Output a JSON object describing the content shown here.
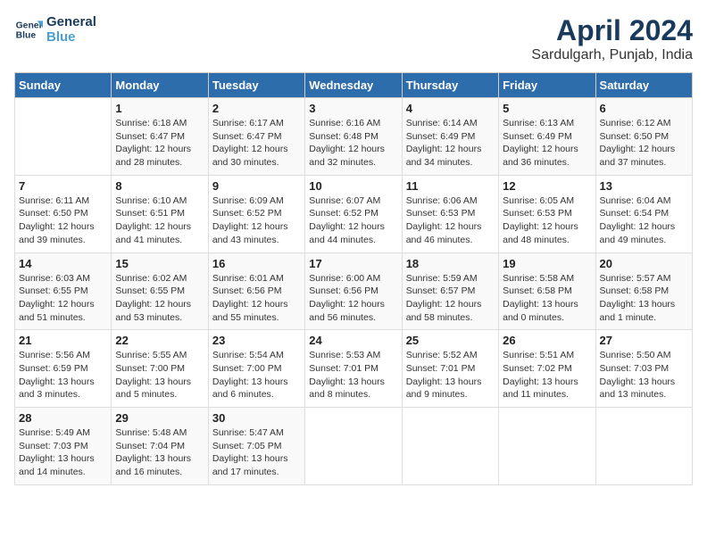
{
  "logo": {
    "line1": "General",
    "line2": "Blue"
  },
  "title": "April 2024",
  "subtitle": "Sardulgarh, Punjab, India",
  "days_header": [
    "Sunday",
    "Monday",
    "Tuesday",
    "Wednesday",
    "Thursday",
    "Friday",
    "Saturday"
  ],
  "weeks": [
    [
      {
        "day": "",
        "info": ""
      },
      {
        "day": "1",
        "info": "Sunrise: 6:18 AM\nSunset: 6:47 PM\nDaylight: 12 hours\nand 28 minutes."
      },
      {
        "day": "2",
        "info": "Sunrise: 6:17 AM\nSunset: 6:47 PM\nDaylight: 12 hours\nand 30 minutes."
      },
      {
        "day": "3",
        "info": "Sunrise: 6:16 AM\nSunset: 6:48 PM\nDaylight: 12 hours\nand 32 minutes."
      },
      {
        "day": "4",
        "info": "Sunrise: 6:14 AM\nSunset: 6:49 PM\nDaylight: 12 hours\nand 34 minutes."
      },
      {
        "day": "5",
        "info": "Sunrise: 6:13 AM\nSunset: 6:49 PM\nDaylight: 12 hours\nand 36 minutes."
      },
      {
        "day": "6",
        "info": "Sunrise: 6:12 AM\nSunset: 6:50 PM\nDaylight: 12 hours\nand 37 minutes."
      }
    ],
    [
      {
        "day": "7",
        "info": "Sunrise: 6:11 AM\nSunset: 6:50 PM\nDaylight: 12 hours\nand 39 minutes."
      },
      {
        "day": "8",
        "info": "Sunrise: 6:10 AM\nSunset: 6:51 PM\nDaylight: 12 hours\nand 41 minutes."
      },
      {
        "day": "9",
        "info": "Sunrise: 6:09 AM\nSunset: 6:52 PM\nDaylight: 12 hours\nand 43 minutes."
      },
      {
        "day": "10",
        "info": "Sunrise: 6:07 AM\nSunset: 6:52 PM\nDaylight: 12 hours\nand 44 minutes."
      },
      {
        "day": "11",
        "info": "Sunrise: 6:06 AM\nSunset: 6:53 PM\nDaylight: 12 hours\nand 46 minutes."
      },
      {
        "day": "12",
        "info": "Sunrise: 6:05 AM\nSunset: 6:53 PM\nDaylight: 12 hours\nand 48 minutes."
      },
      {
        "day": "13",
        "info": "Sunrise: 6:04 AM\nSunset: 6:54 PM\nDaylight: 12 hours\nand 49 minutes."
      }
    ],
    [
      {
        "day": "14",
        "info": "Sunrise: 6:03 AM\nSunset: 6:55 PM\nDaylight: 12 hours\nand 51 minutes."
      },
      {
        "day": "15",
        "info": "Sunrise: 6:02 AM\nSunset: 6:55 PM\nDaylight: 12 hours\nand 53 minutes."
      },
      {
        "day": "16",
        "info": "Sunrise: 6:01 AM\nSunset: 6:56 PM\nDaylight: 12 hours\nand 55 minutes."
      },
      {
        "day": "17",
        "info": "Sunrise: 6:00 AM\nSunset: 6:56 PM\nDaylight: 12 hours\nand 56 minutes."
      },
      {
        "day": "18",
        "info": "Sunrise: 5:59 AM\nSunset: 6:57 PM\nDaylight: 12 hours\nand 58 minutes."
      },
      {
        "day": "19",
        "info": "Sunrise: 5:58 AM\nSunset: 6:58 PM\nDaylight: 13 hours\nand 0 minutes."
      },
      {
        "day": "20",
        "info": "Sunrise: 5:57 AM\nSunset: 6:58 PM\nDaylight: 13 hours\nand 1 minute."
      }
    ],
    [
      {
        "day": "21",
        "info": "Sunrise: 5:56 AM\nSunset: 6:59 PM\nDaylight: 13 hours\nand 3 minutes."
      },
      {
        "day": "22",
        "info": "Sunrise: 5:55 AM\nSunset: 7:00 PM\nDaylight: 13 hours\nand 5 minutes."
      },
      {
        "day": "23",
        "info": "Sunrise: 5:54 AM\nSunset: 7:00 PM\nDaylight: 13 hours\nand 6 minutes."
      },
      {
        "day": "24",
        "info": "Sunrise: 5:53 AM\nSunset: 7:01 PM\nDaylight: 13 hours\nand 8 minutes."
      },
      {
        "day": "25",
        "info": "Sunrise: 5:52 AM\nSunset: 7:01 PM\nDaylight: 13 hours\nand 9 minutes."
      },
      {
        "day": "26",
        "info": "Sunrise: 5:51 AM\nSunset: 7:02 PM\nDaylight: 13 hours\nand 11 minutes."
      },
      {
        "day": "27",
        "info": "Sunrise: 5:50 AM\nSunset: 7:03 PM\nDaylight: 13 hours\nand 13 minutes."
      }
    ],
    [
      {
        "day": "28",
        "info": "Sunrise: 5:49 AM\nSunset: 7:03 PM\nDaylight: 13 hours\nand 14 minutes."
      },
      {
        "day": "29",
        "info": "Sunrise: 5:48 AM\nSunset: 7:04 PM\nDaylight: 13 hours\nand 16 minutes."
      },
      {
        "day": "30",
        "info": "Sunrise: 5:47 AM\nSunset: 7:05 PM\nDaylight: 13 hours\nand 17 minutes."
      },
      {
        "day": "",
        "info": ""
      },
      {
        "day": "",
        "info": ""
      },
      {
        "day": "",
        "info": ""
      },
      {
        "day": "",
        "info": ""
      }
    ]
  ]
}
